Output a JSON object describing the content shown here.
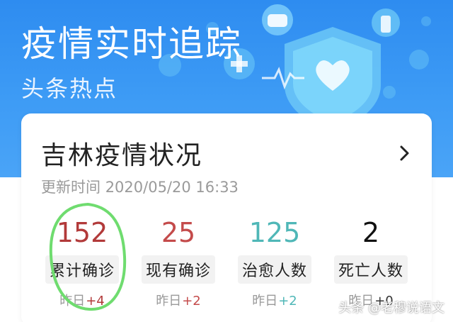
{
  "header": {
    "title": "疫情实时追踪",
    "subtitle": "头条热点"
  },
  "card": {
    "title": "吉林疫情状况",
    "update_label": "更新时间",
    "update_time": "2020/05/20 16:33",
    "stats": [
      {
        "value": "152",
        "label": "累计确诊",
        "delta_label": "昨日",
        "delta_value": "+4",
        "color": "#b23a3a",
        "delta_color": "#b23a3a"
      },
      {
        "value": "25",
        "label": "现有确诊",
        "delta_label": "昨日",
        "delta_value": "+2",
        "color": "#c44b4b",
        "delta_color": "#c44b4b"
      },
      {
        "value": "125",
        "label": "治愈人数",
        "delta_label": "昨日",
        "delta_value": "+2",
        "color": "#4fb7b7",
        "delta_color": "#4fb7b7"
      },
      {
        "value": "2",
        "label": "死亡人数",
        "delta_label": "昨日",
        "delta_value": "+0",
        "color": "#111111",
        "delta_color": "#333333"
      }
    ]
  },
  "watermark": "头条 @老穆说语文",
  "icons": [
    "chevron-right-icon",
    "shield-heart-icon",
    "virus-icon",
    "mask-icon",
    "spray-bottle-icon",
    "medical-cross-icon",
    "heartbeat-line-icon"
  ],
  "colors": {
    "header_bg": "#3d9bf5",
    "highlight_circle": "#6fdc6f"
  }
}
